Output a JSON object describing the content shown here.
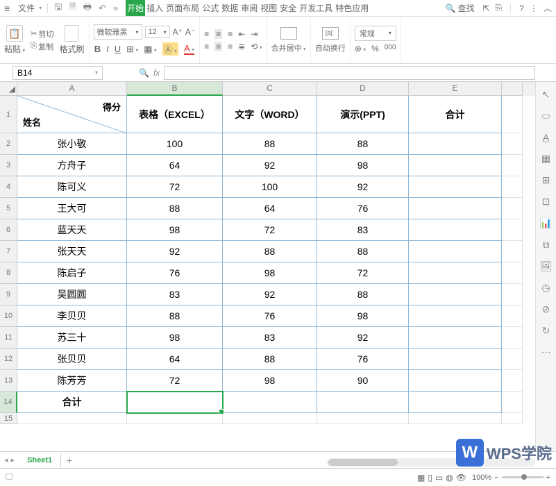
{
  "menubar": {
    "file_label": "文件",
    "search_label": "查找",
    "tabs": [
      "开始",
      "插入",
      "页面布局",
      "公式",
      "数据",
      "审阅",
      "视图",
      "安全",
      "开发工具",
      "特色应用"
    ]
  },
  "ribbon": {
    "cut": "剪切",
    "copy": "复制",
    "format_painter": "格式刷",
    "paste": "粘贴",
    "font_name": "微软雅黑",
    "font_size": "12",
    "merge": "合并居中",
    "wrap": "自动换行",
    "number_format": "常规"
  },
  "cell_ref": "B14",
  "sheet_name": "Sheet1",
  "zoom_label": "100%",
  "watermark": "WPS学院",
  "headers": {
    "diag_top": "得分",
    "diag_bottom": "姓名",
    "b": "表格（EXCEL）",
    "c": "文字（WORD）",
    "d": "演示(PPT)",
    "e": "合计",
    "total": "合计"
  },
  "chart_data": {
    "type": "table",
    "columns": [
      "姓名",
      "表格（EXCEL）",
      "文字（WORD）",
      "演示(PPT)",
      "合计"
    ],
    "rows": [
      {
        "name": "张小敬",
        "b": "100",
        "c": "88",
        "d": "88",
        "e": ""
      },
      {
        "name": "方舟子",
        "b": "64",
        "c": "92",
        "d": "98",
        "e": ""
      },
      {
        "name": "陈可义",
        "b": "72",
        "c": "100",
        "d": "92",
        "e": ""
      },
      {
        "name": "王大可",
        "b": "88",
        "c": "64",
        "d": "76",
        "e": ""
      },
      {
        "name": "蓝天天",
        "b": "98",
        "c": "72",
        "d": "83",
        "e": ""
      },
      {
        "name": "张天天",
        "b": "92",
        "c": "88",
        "d": "88",
        "e": ""
      },
      {
        "name": "陈启子",
        "b": "76",
        "c": "98",
        "d": "72",
        "e": ""
      },
      {
        "name": "吴圆圆",
        "b": "83",
        "c": "92",
        "d": "88",
        "e": ""
      },
      {
        "name": "李贝贝",
        "b": "88",
        "c": "76",
        "d": "98",
        "e": ""
      },
      {
        "name": "苏三十",
        "b": "98",
        "c": "83",
        "d": "92",
        "e": ""
      },
      {
        "name": "张贝贝",
        "b": "64",
        "c": "88",
        "d": "76",
        "e": ""
      },
      {
        "name": "陈芳芳",
        "b": "72",
        "c": "98",
        "d": "90",
        "e": ""
      }
    ]
  }
}
